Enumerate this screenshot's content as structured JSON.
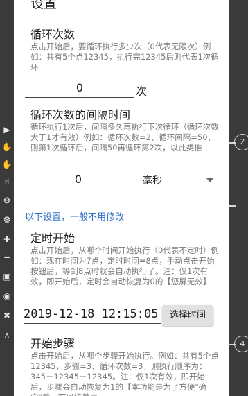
{
  "dialog": {
    "title": "设置",
    "loop_count": {
      "title": "循环次数",
      "description": "点击开始后，要循环执行多少次（0代表无限次）例如：共有5个点12345，执行完12345后则代表1次循环",
      "value": "0",
      "unit": "次"
    },
    "loop_interval": {
      "title": "循环次数的间隔时间",
      "description": "循环执行1次后，间隔多久再执行下次循环（循环次数大于1才有效）例如：循环次数=2、循环间隔=50、则第1次循环后，间隔50再循环第2次，以此类推",
      "value": "0",
      "unit_selected": "毫秒"
    },
    "advanced_hint": "以下设置，一般不用修改",
    "timed_start": {
      "title": "定时开始",
      "description": "点击开始后，从哪个时间开始执行（0代表不定时）例如：现在时间为7点，定时时间=8点，手动点击开始按钮后，等到8点时就会自动执行了。注：仅1次有效，即开始后，定时会自动恢复为0的【您屏无效】",
      "datetime": "2019-12-18  12:15:05",
      "button_label": "选择时间"
    },
    "start_step": {
      "title": "开始步骤",
      "description": "点击开始后，从哪个步骤开始执行。例如：共有5个点12345，步骤=3、循环次数=3，则执行顺序为：345－12345－12345。注：仅1次有效，即开始后，步骤会自动恢复为1的【本功能是为了方便\"确定\"后，可以接着之"
    }
  },
  "background": {
    "right_labels": [
      "2",
      "4"
    ]
  }
}
